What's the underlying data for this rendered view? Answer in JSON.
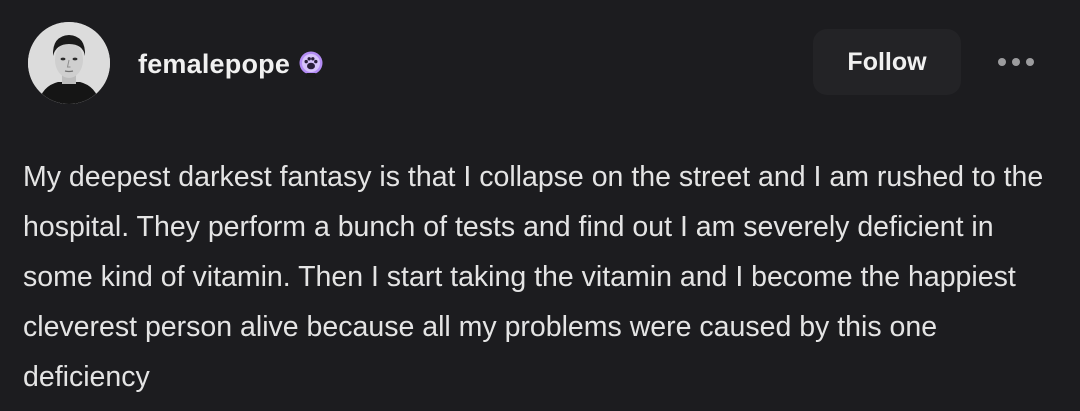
{
  "post": {
    "author": {
      "username": "femalepope",
      "avatar_icon": "user-portrait-avatar",
      "badge_icon": "paw-badge-icon",
      "badge_color": "#b48cf5"
    },
    "actions": {
      "follow_label": "Follow",
      "more_icon": "ellipsis-icon"
    },
    "body": {
      "text": "My deepest darkest fantasy is that I collapse on the street and I am rushed to the hospital. They perform a bunch of tests and find out I am severely deficient in some kind of vitamin. Then I start taking the vitamin and I become the happiest cleverest person alive because all my problems were caused by this one deficiency"
    }
  },
  "colors": {
    "background": "#1c1c1f",
    "button_background": "#232326",
    "text": "#e4e4e4"
  }
}
